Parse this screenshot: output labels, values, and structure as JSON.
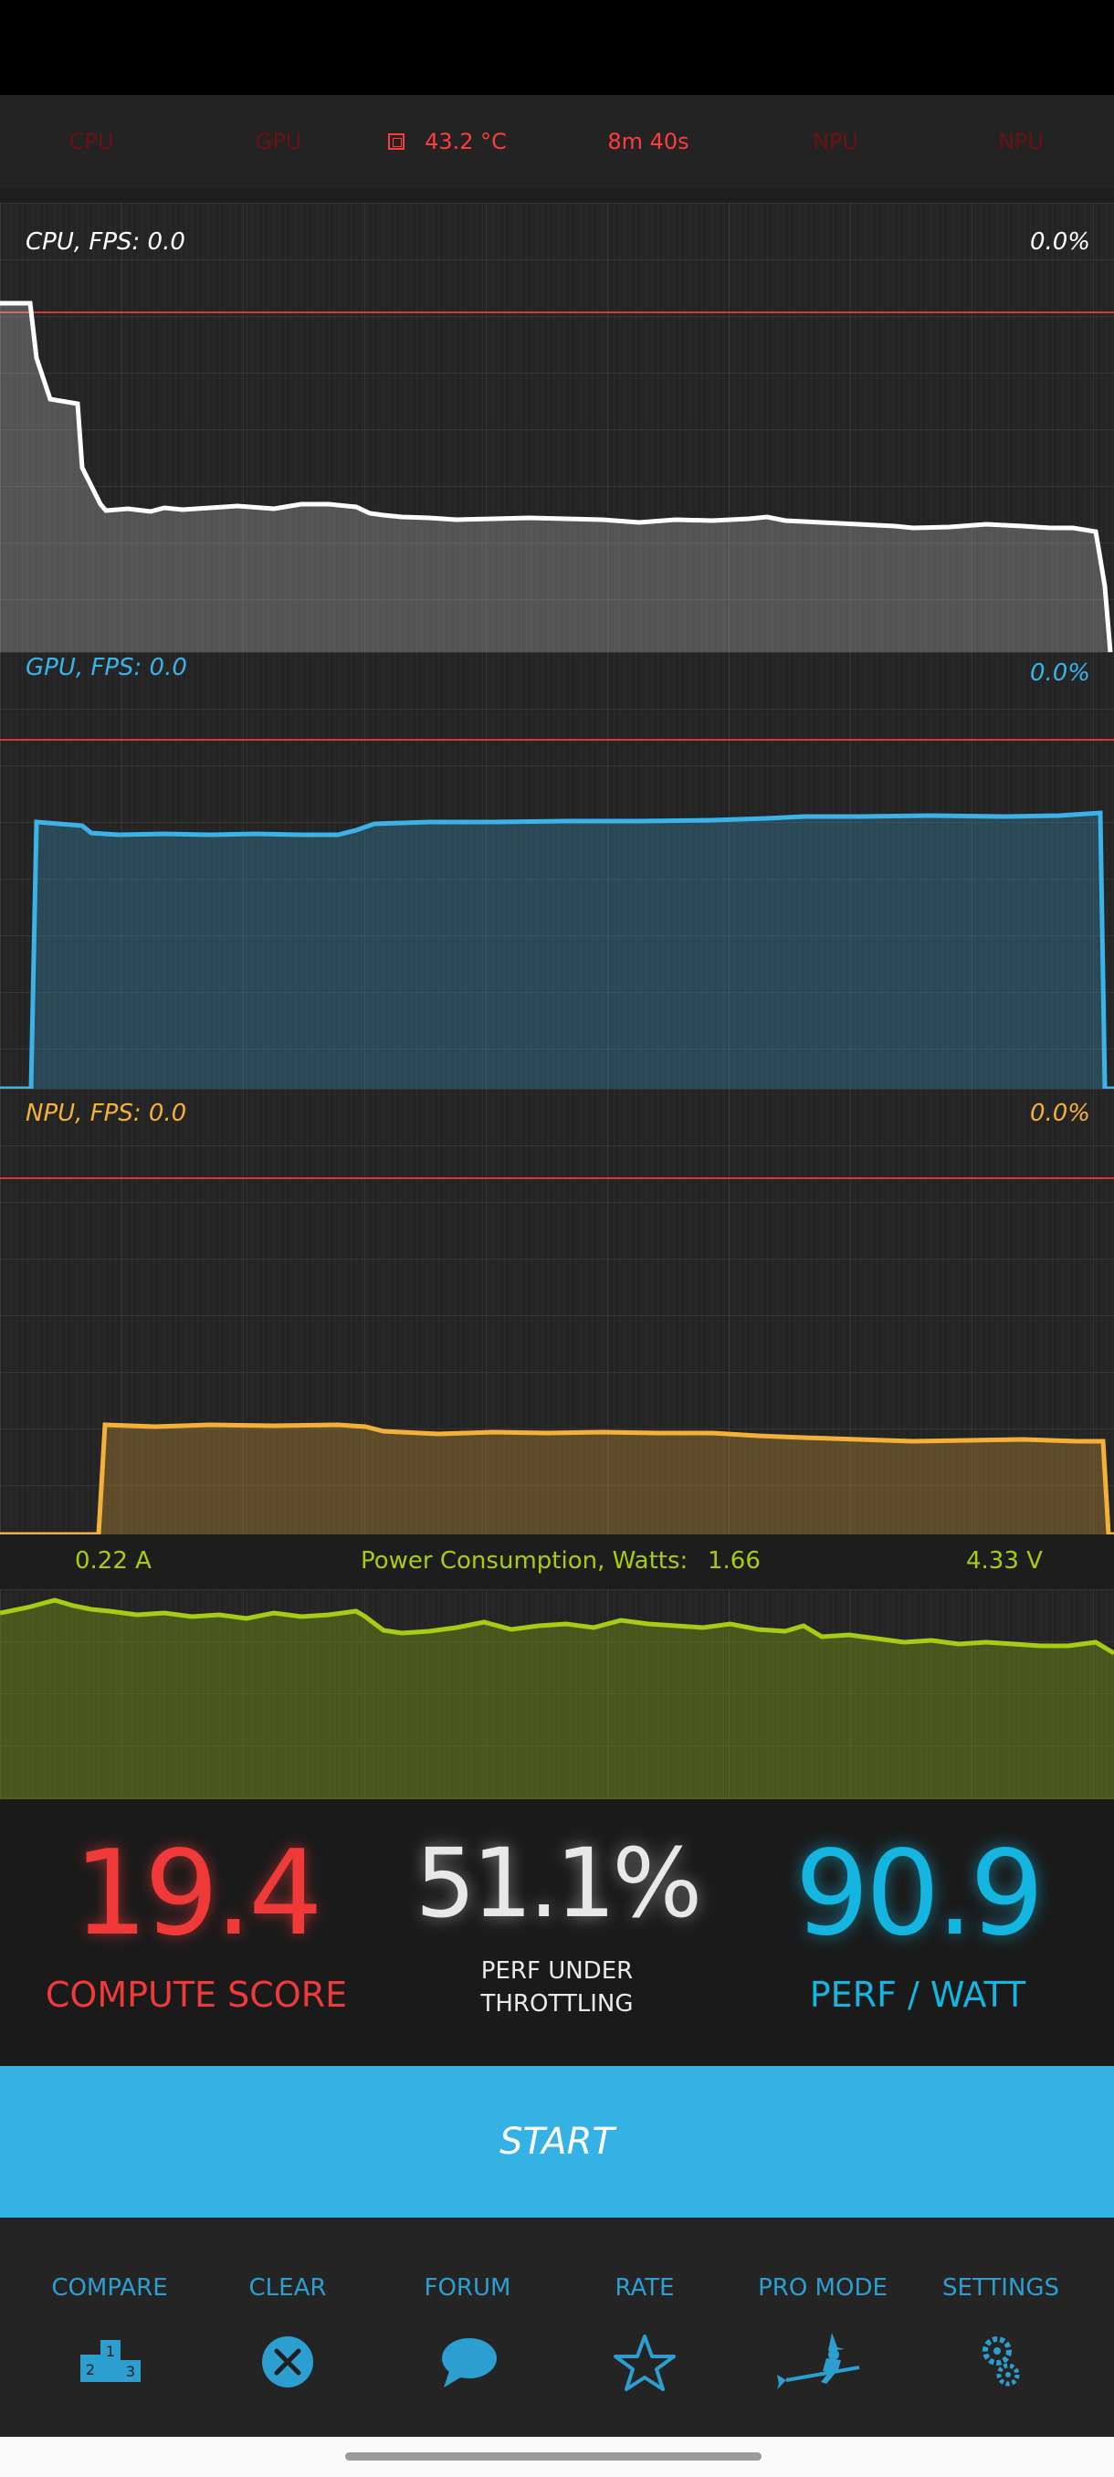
{
  "top_row": {
    "cpu": "CPU",
    "gpu": "GPU",
    "temperature": "43.2 °C",
    "elapsed": "8m 40s",
    "npu1": "NPU",
    "npu2": "NPU"
  },
  "cpu_panel": {
    "label": "CPU, FPS:  0.0",
    "value": "0.0%"
  },
  "gpu_panel": {
    "label": "GPU, FPS:  0.0",
    "value": "0.0%"
  },
  "npu_panel": {
    "label": "NPU, FPS:  0.0",
    "value": "0.0%"
  },
  "power": {
    "current": "0.22 A",
    "label": "Power Consumption, Watts:",
    "watts": "1.66",
    "voltage": "4.33 V"
  },
  "scores": {
    "compute_score": "19.4",
    "compute_label": "COMPUTE SCORE",
    "throttling_value": "51.1%",
    "throttling_label_line1": "PERF UNDER",
    "throttling_label_line2": "THROTTLING",
    "perf_watt": "90.9",
    "perf_watt_label": "PERF / WATT"
  },
  "start_label": "START",
  "nav": [
    {
      "label": "COMPARE",
      "icon": "podium-icon"
    },
    {
      "label": "CLEAR",
      "icon": "clear-x-icon"
    },
    {
      "label": "FORUM",
      "icon": "speech-bubble-icon"
    },
    {
      "label": "RATE",
      "icon": "star-icon"
    },
    {
      "label": "PRO MODE",
      "icon": "witch-icon"
    },
    {
      "label": "SETTINGS",
      "icon": "gears-icon"
    }
  ],
  "colors": {
    "cpu": "#ffffff",
    "gpu": "#3bb3e8",
    "npu": "#f4b13a",
    "power": "#a7cc16",
    "threshold": "#d23a3a",
    "accent": "#33b2e3"
  }
}
